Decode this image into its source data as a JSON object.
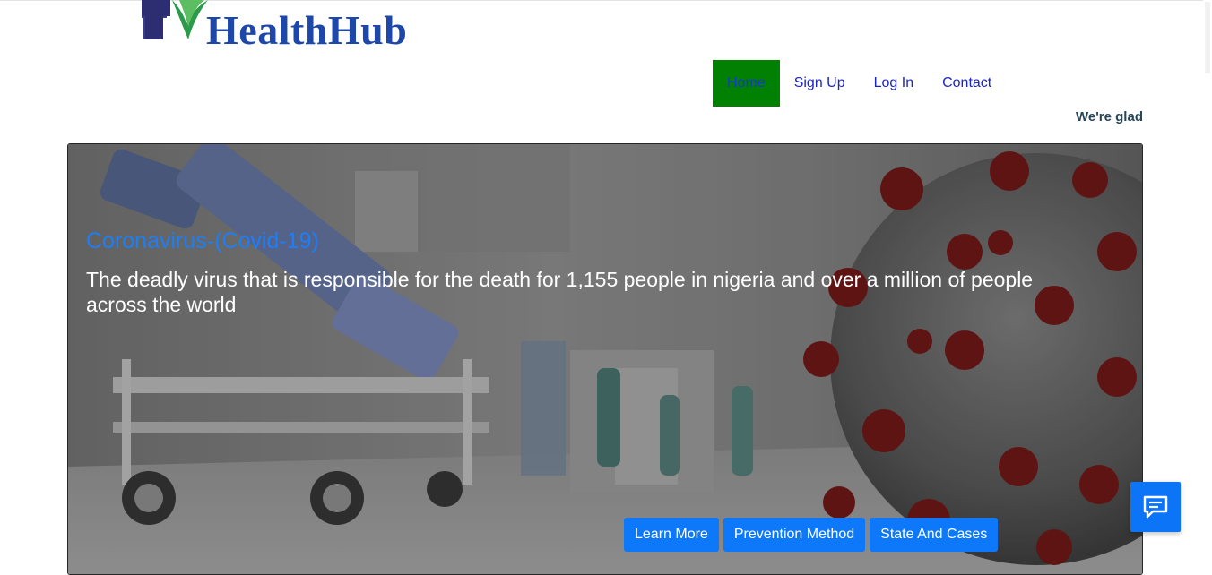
{
  "brand": {
    "name": "HealthHub",
    "color": "#1d47a8"
  },
  "nav": {
    "items": [
      {
        "label": "Home",
        "active": true
      },
      {
        "label": "Sign Up",
        "active": false
      },
      {
        "label": "Log In",
        "active": false
      },
      {
        "label": "Contact",
        "active": false
      }
    ],
    "active_color": "#018001"
  },
  "ticker": {
    "text": "We're glad"
  },
  "hero": {
    "title": "Coronavirus-(Covid-19)",
    "description": "The deadly virus that is responsible for the death for 1,155 people in nigeria and over a million of people across the world",
    "buttons": [
      {
        "label": "Learn More"
      },
      {
        "label": "Prevention Method"
      },
      {
        "label": "State And Cases"
      }
    ],
    "button_color": "#0d78fa"
  },
  "chat": {
    "icon": "chat-bubble-icon",
    "color": "#0b74f7"
  }
}
